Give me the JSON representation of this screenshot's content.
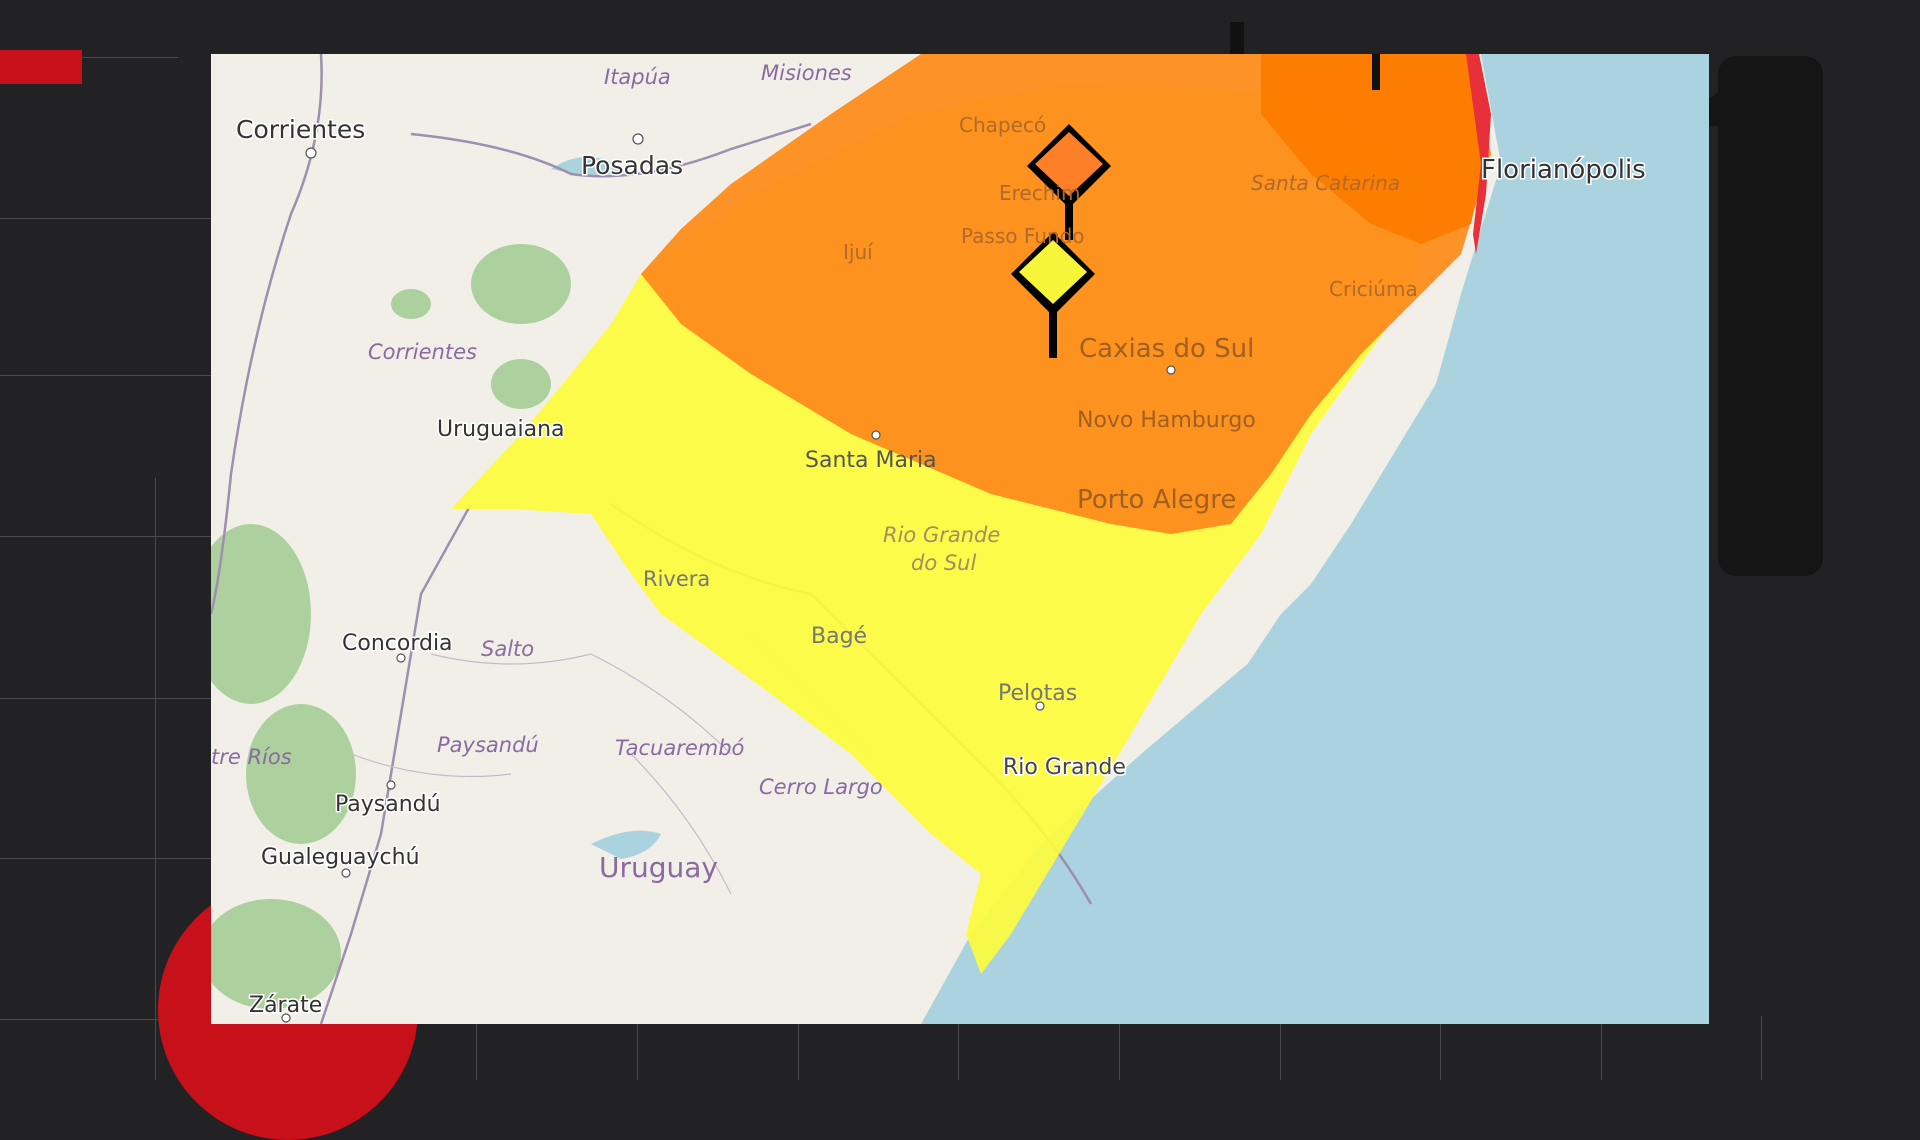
{
  "map": {
    "cities": [
      {
        "key": "corrientes_city",
        "name": "Corrientes"
      },
      {
        "key": "posadas",
        "name": "Posadas"
      },
      {
        "key": "florianopolis",
        "name": "Florianópolis"
      },
      {
        "key": "uruguaiana",
        "name": "Uruguaiana"
      },
      {
        "key": "santa_maria",
        "name": "Santa Maria"
      },
      {
        "key": "caxias",
        "name": "Caxias do Sul"
      },
      {
        "key": "novo_hamburgo",
        "name": "Novo Hamburgo"
      },
      {
        "key": "porto_alegre",
        "name": "Porto Alegre"
      },
      {
        "key": "rivera",
        "name": "Rivera"
      },
      {
        "key": "bage",
        "name": "Bagé"
      },
      {
        "key": "pelotas",
        "name": "Pelotas"
      },
      {
        "key": "rio_grande",
        "name": "Rio Grande"
      },
      {
        "key": "concordia",
        "name": "Concordia"
      },
      {
        "key": "paysandu_city",
        "name": "Paysandú"
      },
      {
        "key": "gualeguaychu",
        "name": "Gualeguaychú"
      },
      {
        "key": "zarate",
        "name": "Zárate"
      },
      {
        "key": "ijui",
        "name": "Ijuí"
      },
      {
        "key": "passo_fundo",
        "name": "Passo Fundo"
      },
      {
        "key": "erechim",
        "name": "Erechim"
      },
      {
        "key": "chapeco",
        "name": "Chapecó"
      },
      {
        "key": "criciuma",
        "name": "Criciúma"
      }
    ],
    "regions": [
      {
        "key": "itapua",
        "name": "Itapúa"
      },
      {
        "key": "misiones",
        "name": "Misiones"
      },
      {
        "key": "corrientes_prov",
        "name": "Corrientes"
      },
      {
        "key": "rio_grande_do_sul_1",
        "name": "Rio Grande"
      },
      {
        "key": "rio_grande_do_sul_2",
        "name": "do Sul"
      },
      {
        "key": "salto",
        "name": "Salto"
      },
      {
        "key": "paysandu_dept",
        "name": "Paysandú"
      },
      {
        "key": "tacuarembo",
        "name": "Tacuarembó"
      },
      {
        "key": "cerro_largo",
        "name": "Cerro Largo"
      },
      {
        "key": "entre_rios",
        "name": "tre Ríos"
      },
      {
        "key": "santa_catarina",
        "name": "Santa Catarina"
      }
    ],
    "country": {
      "name": "Uruguay"
    },
    "colors": {
      "water": "#aad3df",
      "land": "#f2efe9",
      "alert_yellow": "#fdfc3c",
      "alert_orange": "#fd8c1c",
      "alert_dark_orange": "#fd7c00",
      "alert_red": "#e8303a",
      "forest": "#add19e",
      "border": "#9e8fb0"
    },
    "markers": [
      {
        "key": "marker_orange",
        "icon": "warning-orange-icon",
        "color": "#fd7f28"
      },
      {
        "key": "marker_yellow",
        "icon": "warning-yellow-icon",
        "color": "#f6f53a"
      }
    ]
  }
}
